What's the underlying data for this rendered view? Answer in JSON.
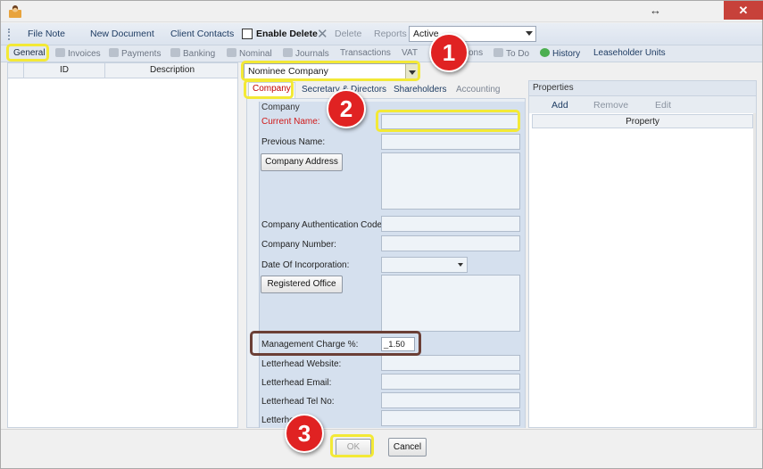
{
  "window": {
    "close_glyph": "✕",
    "resize_glyph": "↔",
    "app_icon": "user-icon"
  },
  "toolbar": {
    "file_note": "File Note",
    "new_document": "New Document",
    "client_contacts": "Client Contacts",
    "enable_delete": "Enable Delete",
    "delete": "Delete",
    "reports": "Reports",
    "status_select": "Active"
  },
  "nav_tabs": {
    "general": "General",
    "invoices": "Invoices",
    "payments": "Payments",
    "banking": "Banking",
    "nominal": "Nominal",
    "journals": "Journals",
    "transactions": "Transactions",
    "vat": "VAT",
    "partial_hidden": "ons",
    "to_do": "To Do",
    "history": "History",
    "leaseholder_units": "Leaseholder Units"
  },
  "left_grid": {
    "col_id": "ID",
    "col_description": "Description"
  },
  "entity_select": "Nominee Company",
  "sub_tabs": {
    "company": "Company",
    "secretary_directors": "Secretary & Directors",
    "shareholders": "Shareholders",
    "accounting": "Accounting"
  },
  "form": {
    "group_title": "Company",
    "current_name": "Current Name:",
    "previous_name": "Previous Name:",
    "company_address_btn": "Company Address",
    "auth_code": "Company Authentication Code:",
    "company_number": "Company Number:",
    "date_of_incorporation": "Date Of Incorporation:",
    "registered_office_btn": "Registered Office",
    "management_charge": "Management Charge %:",
    "management_charge_value": "_1.50",
    "letterhead_website": "Letterhead Website:",
    "letterhead_email": "Letterhead Email:",
    "letterhead_tel": "Letterhead Tel No:",
    "letterhead_fax": "Letterhe     No:"
  },
  "properties": {
    "title": "Properties",
    "add": "Add",
    "remove": "Remove",
    "edit": "Edit",
    "col_property": "Property"
  },
  "footer": {
    "ok": "OK",
    "cancel": "Cancel"
  },
  "callouts": {
    "one": "1",
    "two": "2",
    "three": "3"
  },
  "colors": {
    "callout": "#e02222",
    "highlight": "#f3e936",
    "highlight_brown": "#6b3f36",
    "required_label": "#d01818"
  }
}
